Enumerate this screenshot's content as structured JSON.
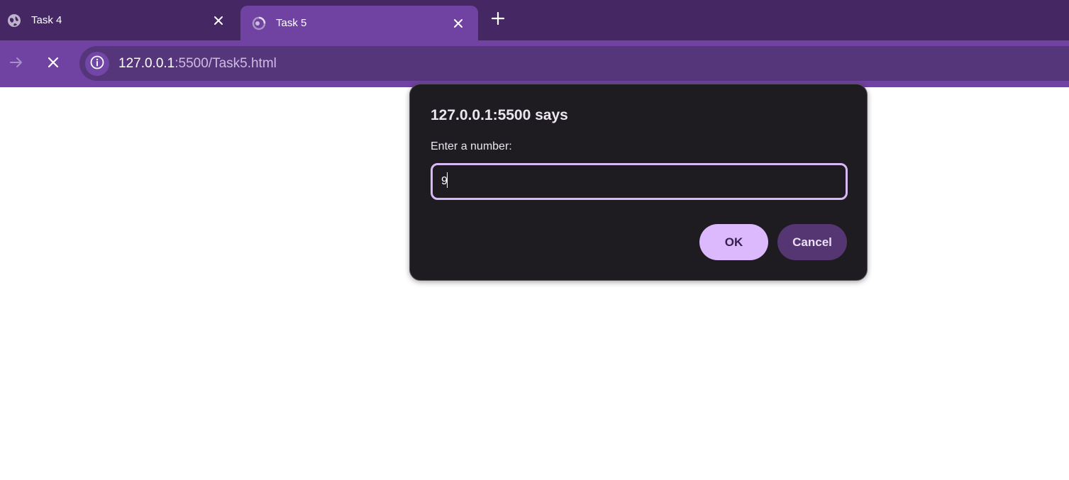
{
  "browser": {
    "tabs": [
      {
        "title": "Task 4",
        "icon": "globe-icon",
        "active": false
      },
      {
        "title": "Task 5",
        "icon": "loading-icon",
        "active": true
      }
    ],
    "new_tab_icon": "plus-icon",
    "toolbar": {
      "forward_icon": "arrow-right-icon",
      "stop_icon": "close-icon",
      "site_info_icon": "info-icon",
      "url_host": "127.0.0.1",
      "url_rest": ":5500/Task5.html"
    }
  },
  "dialog": {
    "title": "127.0.0.1:5500 says",
    "message": "Enter a number:",
    "input_value": "9",
    "ok_label": "OK",
    "cancel_label": "Cancel"
  },
  "colors": {
    "tabstrip": "#452764",
    "toolbar": "#7042a1",
    "omnibox": "#55367b",
    "dialog_bg": "#1e1c20",
    "accent": "#dcb8fd"
  }
}
